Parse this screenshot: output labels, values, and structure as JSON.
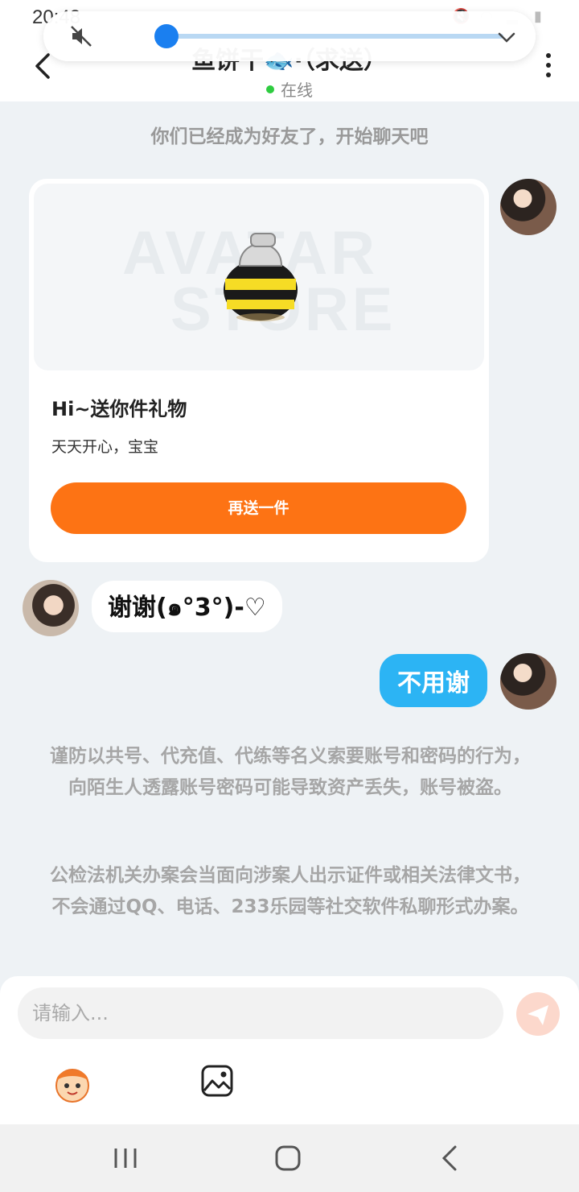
{
  "status_bar": {
    "time": "20:48"
  },
  "header": {
    "title": "鱼饼干🐟·（求送）",
    "online_label": "在线"
  },
  "system_notice": "你们已经成为好友了，开始聊天吧",
  "gift_card": {
    "watermark_line1": "AVATAR",
    "watermark_line2": "STORE",
    "title": "Hi~送你件礼物",
    "subtitle": "天天开心，宝宝",
    "button_label": "再送一件"
  },
  "messages": [
    {
      "side": "left",
      "text": "谢谢(๑°3°)-♡"
    },
    {
      "side": "right",
      "text": "不用谢"
    }
  ],
  "warnings": [
    "谨防以共号、代充值、代练等名义索要账号和密码的行为，向陌生人透露账号密码可能导致资产丢失，账号被盗。",
    "公检法机关办案会当面向涉案人出示证件或相关法律文书，不会通过QQ、电话、233乐园等社交软件私聊形式办案。"
  ],
  "composer": {
    "placeholder": "请输入..."
  },
  "colors": {
    "accent_orange": "#fd7314",
    "bubble_blue": "#2cb4f4",
    "online_green": "#2ecc40",
    "volume_blue": "#1a7ff0"
  },
  "volume": {
    "level_percent": 3
  }
}
